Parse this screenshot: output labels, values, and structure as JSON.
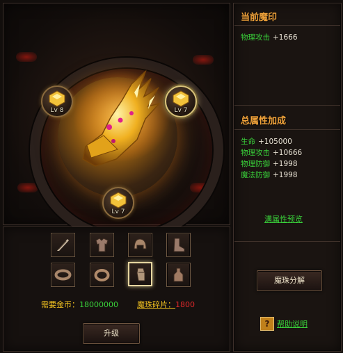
{
  "gems": [
    {
      "label": "Lv 8",
      "selected": false
    },
    {
      "label": "Lv 7",
      "selected": true
    },
    {
      "label": "Lv 7",
      "selected": false
    }
  ],
  "items": {
    "slots": [
      {
        "icon": "feather-icon"
      },
      {
        "icon": "armor-icon"
      },
      {
        "icon": "helmet-icon"
      },
      {
        "icon": "boots-icon"
      },
      {
        "icon": "bracelet-icon"
      },
      {
        "icon": "ring-icon"
      },
      {
        "icon": "gauntlet-icon",
        "active": true
      },
      {
        "icon": "bottle-icon"
      }
    ],
    "gold_label": "需要金币：",
    "gold_value": "18000000",
    "shard_label": "魔珠碎片：",
    "shard_value": "1800",
    "upgrade_button": "升级"
  },
  "right": {
    "current_title": "当前魔印",
    "current_stats": [
      {
        "name": "物理攻击",
        "value": "+1666"
      }
    ],
    "total_title": "总属性加成",
    "total_stats": [
      {
        "name": "生命",
        "value": "+105000"
      },
      {
        "name": "物理攻击",
        "value": "+10666"
      },
      {
        "name": "物理防御",
        "value": "+1998"
      },
      {
        "name": "魔法防御",
        "value": "+1998"
      }
    ],
    "preview_link": "满属性预览",
    "decompose_button": "魔珠分解",
    "help_icon_glyph": "?",
    "help_link": "帮助说明"
  },
  "colors": {
    "accent_orange": "#f0a23a",
    "stat_green": "#39d13a",
    "gold_text": "#f0c020",
    "shard_value_red": "#e0282a"
  }
}
